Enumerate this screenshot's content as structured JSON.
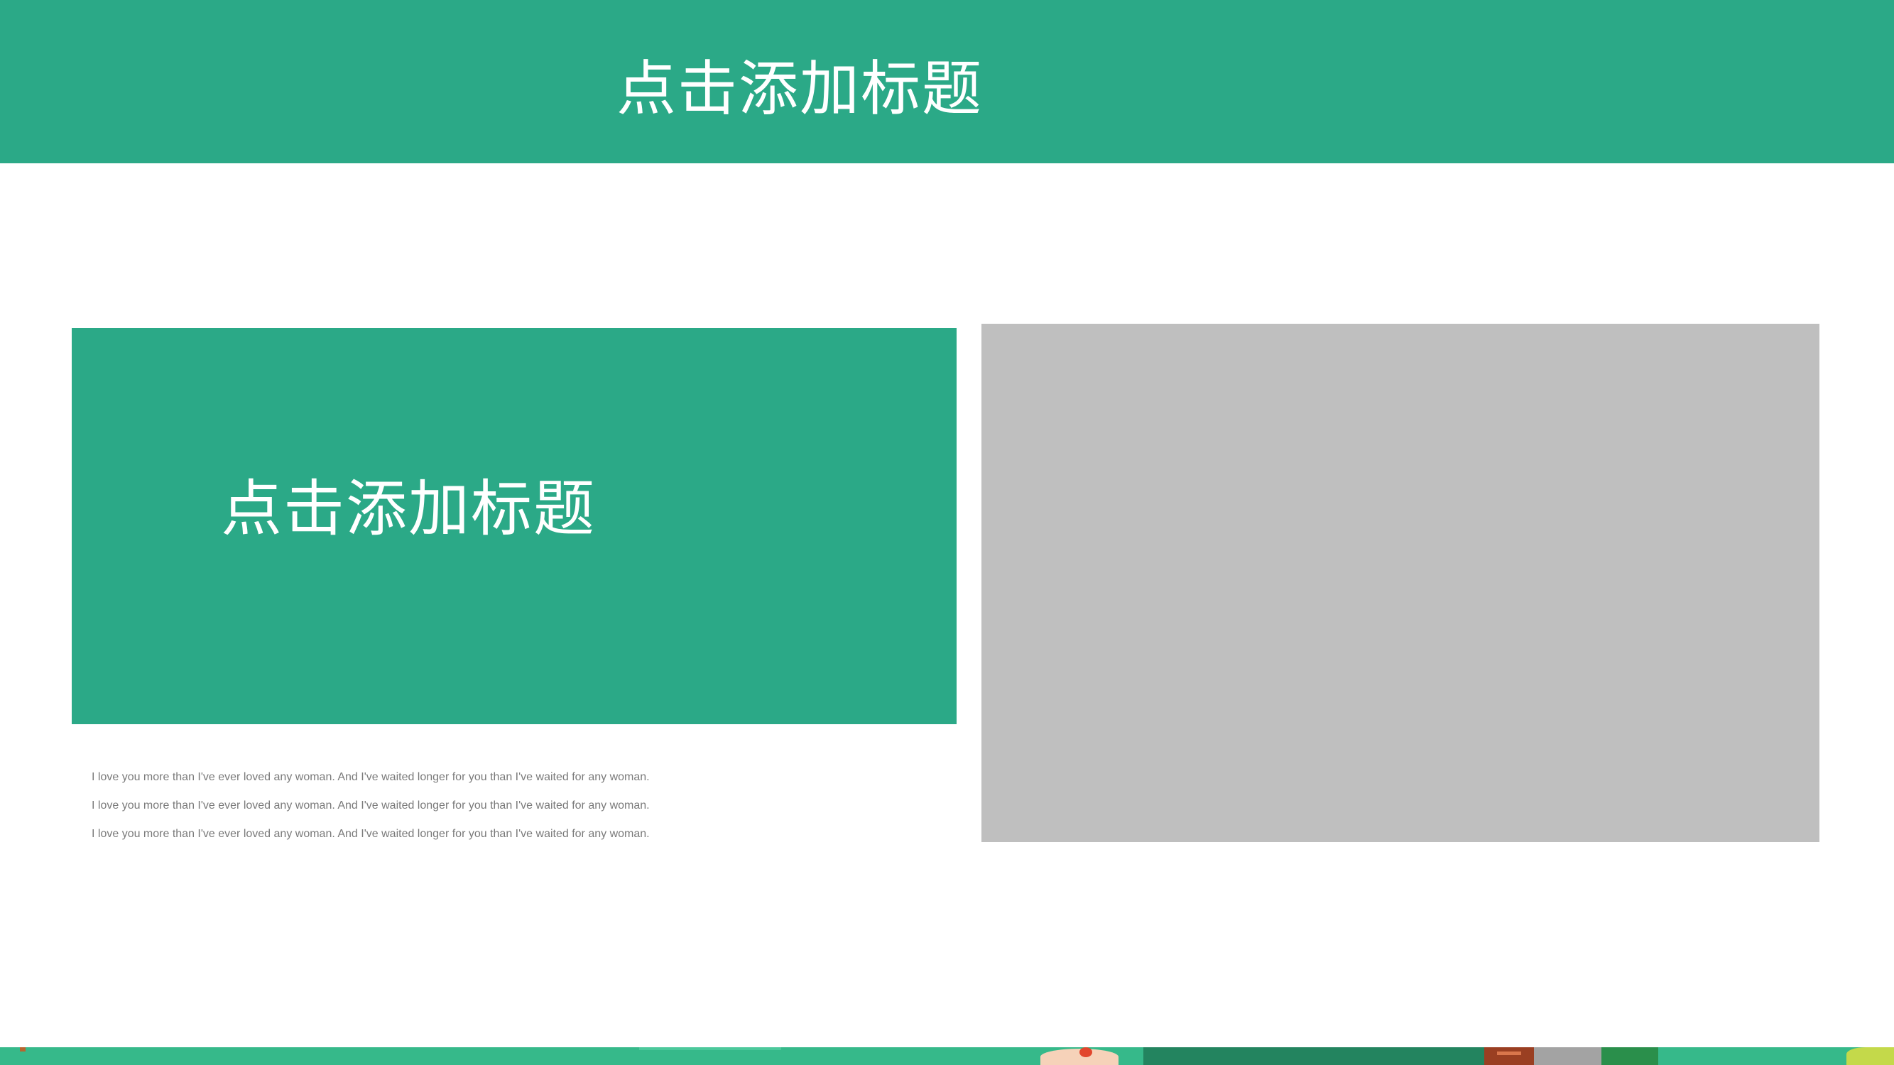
{
  "slide": {
    "header_title": "点击添加标题",
    "block_title": "点击添加标题",
    "body_lines": [
      "I love you more than I've ever loved any woman. And I've waited longer for you than I've waited for any woman.",
      "I love you more than I've ever loved any woman. And I've waited longer for you than I've waited for any woman.",
      "I love you more than I've ever loved any woman. And I've waited longer for you than I've waited for any woman."
    ]
  },
  "colors": {
    "primary_green": "#2ba987",
    "placeholder_gray": "#bfbfbf",
    "body_text": "#7a7a7a",
    "title_text": "#ffffff"
  },
  "icons": {
    "bottom_decoration": "cartoon-scene-illustration"
  }
}
